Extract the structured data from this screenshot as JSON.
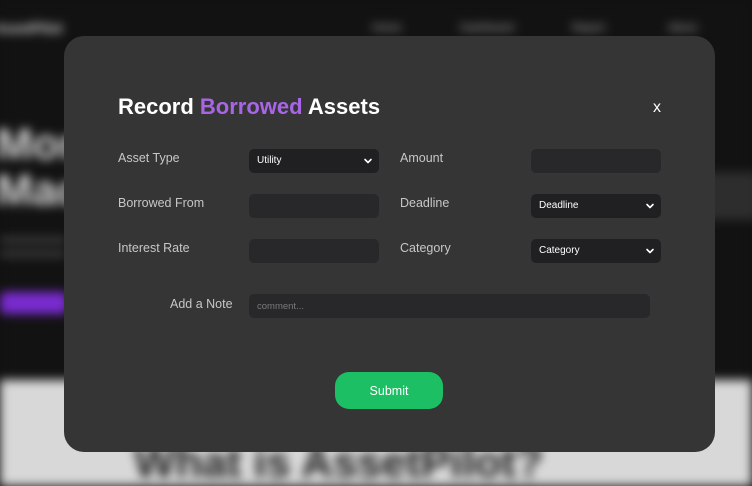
{
  "background": {
    "logo": "AssetPilot",
    "nav": [
      "Home",
      "Dashboard",
      "Report",
      "About"
    ],
    "hero_lines": [
      "More",
      "Mac"
    ],
    "section_heading": "What is AssetPilot?"
  },
  "modal": {
    "title_prefix": "Record ",
    "title_accent": "Borrowed",
    "title_suffix": " Assets",
    "close_label": "x",
    "fields": {
      "asset_type": {
        "label": "Asset Type",
        "value": "Utility"
      },
      "amount": {
        "label": "Amount",
        "value": ""
      },
      "borrowed_from": {
        "label": "Borrowed From",
        "value": ""
      },
      "deadline": {
        "label": "Deadline",
        "value": "Deadline"
      },
      "interest_rate": {
        "label": "Interest Rate",
        "value": ""
      },
      "category": {
        "label": "Category",
        "value": "Category"
      }
    },
    "note": {
      "label": "Add a Note",
      "placeholder": "comment..."
    },
    "submit_label": "Submit"
  },
  "colors": {
    "accent": "#a866e6",
    "submit": "#1cbf63",
    "modal_bg": "#353536"
  }
}
